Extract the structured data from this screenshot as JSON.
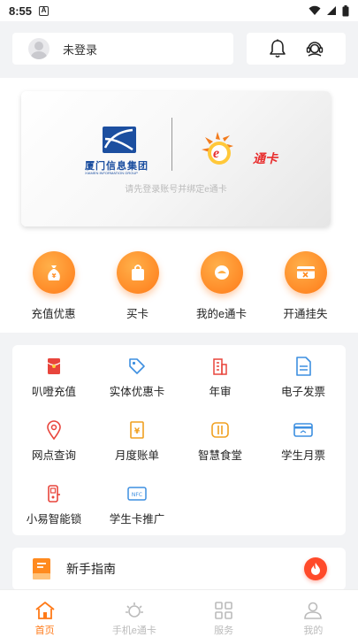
{
  "status_bar": {
    "time": "8:55",
    "notification_icon": "A"
  },
  "header": {
    "login_text": "未登录"
  },
  "banner": {
    "company_name": "厦门信息集团",
    "company_sub": "XIAMEN INFORMATION GROUP",
    "card_brand": "通卡",
    "card_brand_prefix": "e",
    "hint": "请先登录账号并绑定e通卡"
  },
  "quick_actions": [
    {
      "label": "充值优惠",
      "icon": "money-bag-icon"
    },
    {
      "label": "买卡",
      "icon": "shopping-bag-icon"
    },
    {
      "label": "我的e通卡",
      "icon": "card-icon"
    },
    {
      "label": "开通挂失",
      "icon": "card-cancel-icon"
    }
  ],
  "services": [
    {
      "label": "叭噔充值",
      "icon": "red-envelope-icon",
      "color": "#e8453c"
    },
    {
      "label": "实体优惠卡",
      "icon": "tag-icon",
      "color": "#3d8fe0"
    },
    {
      "label": "年审",
      "icon": "building-icon",
      "color": "#e8453c"
    },
    {
      "label": "电子发票",
      "icon": "document-icon",
      "color": "#3d8fe0"
    },
    {
      "label": "网点查询",
      "icon": "location-pin-icon",
      "color": "#e8453c"
    },
    {
      "label": "月度账单",
      "icon": "bill-icon",
      "color": "#f0a020"
    },
    {
      "label": "智慧食堂",
      "icon": "canteen-icon",
      "color": "#f0a020"
    },
    {
      "label": "学生月票",
      "icon": "student-ticket-icon",
      "color": "#3d8fe0"
    },
    {
      "label": "小易智能锁",
      "icon": "smart-lock-icon",
      "color": "#e8453c"
    },
    {
      "label": "学生卡推广",
      "icon": "nfc-card-icon",
      "color": "#3d8fe0"
    }
  ],
  "guide": {
    "label": "新手指南"
  },
  "tabs": [
    {
      "label": "首页",
      "active": true
    },
    {
      "label": "手机e通卡",
      "active": false
    },
    {
      "label": "服务",
      "active": false
    },
    {
      "label": "我的",
      "active": false
    }
  ],
  "colors": {
    "accent": "#ff7a18",
    "inactive": "#bbbbbb",
    "background": "#f2f3f5"
  }
}
